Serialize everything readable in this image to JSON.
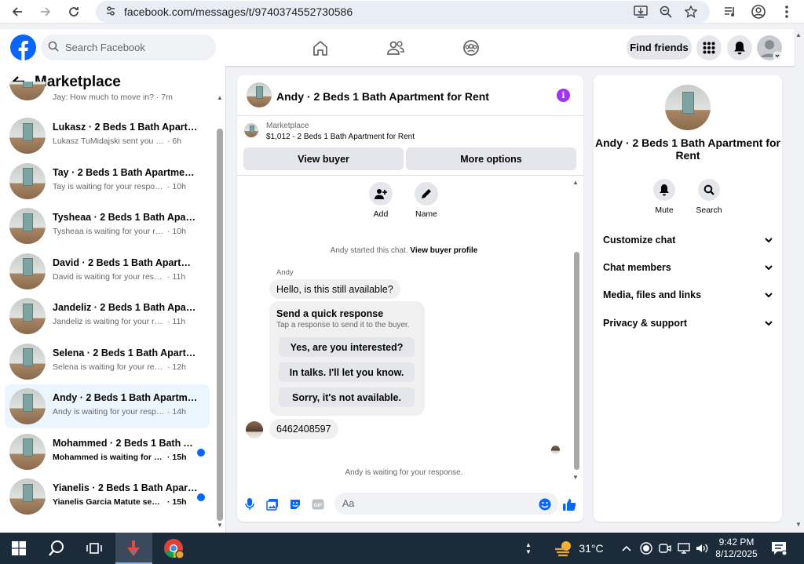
{
  "browser": {
    "url": "facebook.com/messages/t/9740374552730586"
  },
  "fb_header": {
    "search_placeholder": "Search Facebook",
    "find_friends_label": "Find friends"
  },
  "sidebar": {
    "title": "Marketplace",
    "partial_top_preview": "Jay: How much to move in? · 7m",
    "conversations": [
      {
        "name": "Lukasz · 2 Beds 1 Bath Apartme...",
        "preview": "Lukasz TuMidajski sent you a mess...",
        "time": "· 6h",
        "unread": false,
        "active": false
      },
      {
        "name": "Tay · 2 Beds 1 Bath Apartment f...",
        "preview": "Tay is waiting for your response.",
        "time": "· 10h",
        "unread": false,
        "active": false
      },
      {
        "name": "Tysheaa · 2 Beds 1 Bath Apartm...",
        "preview": "Tysheaa is waiting for your respo...",
        "time": "· 10h",
        "unread": false,
        "active": false
      },
      {
        "name": "David · 2 Beds 1 Bath Apartmen...",
        "preview": "David is waiting for your response.",
        "time": "· 11h",
        "unread": false,
        "active": false
      },
      {
        "name": "Jandeliz · 2 Beds 1 Bath Apartm...",
        "preview": "Jandeliz is waiting for your respo...",
        "time": "· 11h",
        "unread": false,
        "active": false
      },
      {
        "name": "Selena · 2 Beds 1 Bath Apartme...",
        "preview": "Selena is waiting for your respon...",
        "time": "· 12h",
        "unread": false,
        "active": false
      },
      {
        "name": "Andy · 2 Beds 1 Bath Apartment...",
        "preview": "Andy is waiting for your response.",
        "time": "· 14h",
        "unread": false,
        "active": true
      },
      {
        "name": "Mohammed · 2 Beds 1 Bath A...",
        "preview": "Mohammed is waiting for you...",
        "time": "· 15h",
        "unread": true,
        "active": false
      },
      {
        "name": "Yianelis · 2 Beds 1 Bath Apart...",
        "preview": "Yianelis Garcia Matute sent yo...",
        "time": "· 15h",
        "unread": true,
        "active": false
      }
    ]
  },
  "chat": {
    "title": "Andy · 2 Beds 1 Bath Apartment for Rent",
    "listing_source": "Marketplace",
    "listing_price_title": "$1,012 - 2 Beds 1 Bath Apartment for Rent",
    "view_buyer_label": "View buyer",
    "more_options_label": "More options",
    "actions": [
      {
        "label": "Add",
        "icon": "add-person-icon"
      },
      {
        "label": "Name",
        "icon": "pencil-icon"
      }
    ],
    "system_message_prefix": "Andy started this chat.",
    "system_message_link": "View buyer profile",
    "sender_name": "Andy",
    "buyer_message": "Hello, is this still available?",
    "quick_response_title": "Send a quick response",
    "quick_response_subtitle": "Tap a response to send it to the buyer.",
    "quick_responses": [
      "Yes, are you interested?",
      "In talks. I'll let you know.",
      "Sorry, it's not available."
    ],
    "phone_message": "6462408597",
    "waiting_text": "Andy is waiting for your response.",
    "composer_placeholder": "Aa"
  },
  "details": {
    "title": "Andy · 2 Beds 1 Bath Apartment for Rent",
    "actions": [
      {
        "label": "Mute",
        "icon": "bell-icon"
      },
      {
        "label": "Search",
        "icon": "search-icon"
      }
    ],
    "sections": [
      "Customize chat",
      "Chat members",
      "Media, files and links",
      "Privacy & support"
    ]
  },
  "taskbar": {
    "temperature": "31°C",
    "time": "9:42 PM",
    "date": "8/12/2025"
  },
  "colors": {
    "brand_blue": "#0866ff",
    "info_purple": "#a033ff",
    "taskbar_bg": "#1c2b3a",
    "active_conv_bg": "#ebf5ff"
  }
}
